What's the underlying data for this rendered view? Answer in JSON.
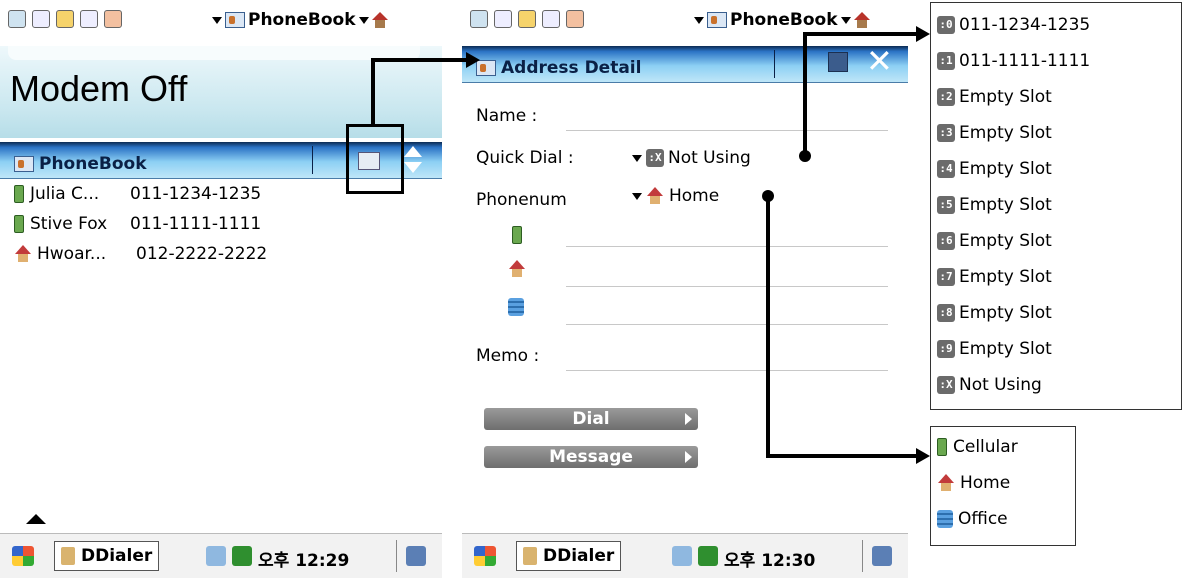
{
  "left_screen": {
    "app_title": "PhoneBook",
    "status_banner": "Modem Off",
    "list_header": "PhoneBook",
    "contacts": [
      {
        "icon": "cellular-icon",
        "name": "Julia C...",
        "number": "011-1234-1235"
      },
      {
        "icon": "cellular-icon",
        "name": "Stive Fox",
        "number": "011-1111-1111"
      },
      {
        "icon": "home-icon",
        "name": "Hwoar...",
        "number": "012-2222-2222"
      }
    ],
    "taskbar": {
      "app_button": "DDialer",
      "time": "오후 12:29"
    }
  },
  "right_screen": {
    "app_title": "PhoneBook",
    "dialog_title": "Address Detail",
    "labels": {
      "name": "Name :",
      "quick_dial": "Quick Dial :",
      "phonenum": "Phonenum",
      "memo": "Memo :"
    },
    "quick_dial_value": "Not Using",
    "quick_dial_badge": ":X",
    "phone_type_value": "Home",
    "buttons": {
      "dial": "Dial",
      "message": "Message"
    },
    "taskbar": {
      "app_button": "DDialer",
      "time": "오후 12:30"
    }
  },
  "quick_dial_popup": {
    "items": [
      {
        "badge": ":0",
        "label": "011-1234-1235"
      },
      {
        "badge": ":1",
        "label": "011-1111-1111"
      },
      {
        "badge": ":2",
        "label": "Empty Slot"
      },
      {
        "badge": ":3",
        "label": "Empty Slot"
      },
      {
        "badge": ":4",
        "label": "Empty Slot"
      },
      {
        "badge": ":5",
        "label": "Empty Slot"
      },
      {
        "badge": ":6",
        "label": "Empty Slot"
      },
      {
        "badge": ":7",
        "label": "Empty Slot"
      },
      {
        "badge": ":8",
        "label": "Empty Slot"
      },
      {
        "badge": ":9",
        "label": "Empty Slot"
      },
      {
        "badge": ":X",
        "label": "Not Using"
      }
    ]
  },
  "phone_type_popup": {
    "items": [
      {
        "icon": "cellular-icon",
        "label": "Cellular"
      },
      {
        "icon": "home-icon",
        "label": "Home"
      },
      {
        "icon": "office-icon",
        "label": "Office"
      }
    ]
  },
  "colors": {
    "title_bar_gradient_top": "#0b2a52",
    "title_bar_gradient_bottom": "#bfe6f8",
    "button_gray": "#7e7e7e"
  }
}
